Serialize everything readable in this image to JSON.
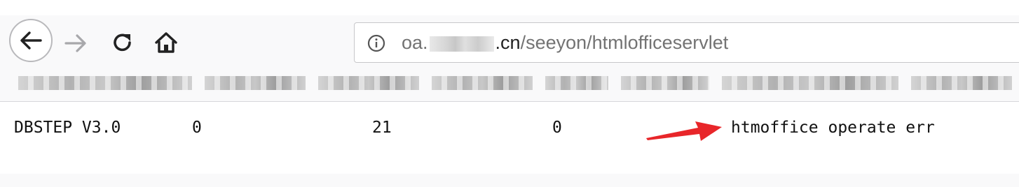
{
  "browser": {
    "nav": {
      "back_icon": "arrow-left-icon",
      "forward_icon": "arrow-right-icon",
      "reload_icon": "reload-icon",
      "home_icon": "home-icon"
    },
    "url": {
      "prefix": "oa.",
      "tld": ".cn",
      "path": "/seeyon/htmlofficeservlet"
    }
  },
  "page": {
    "row": [
      "DBSTEP V3.0",
      "0",
      "21",
      "0",
      "htmoffice operate err"
    ]
  },
  "annotation": {
    "arrow_color": "#e8262a"
  }
}
